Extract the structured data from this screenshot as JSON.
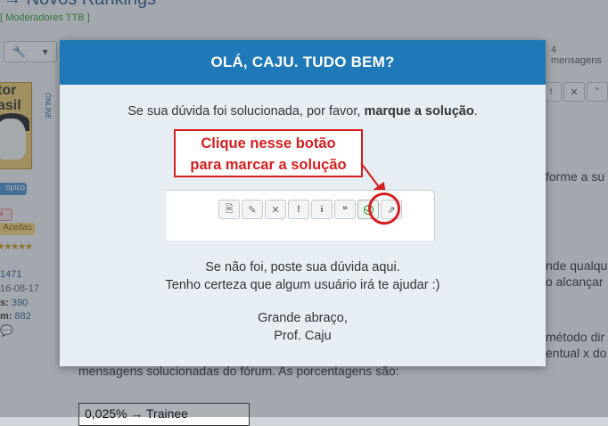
{
  "background": {
    "page_title": "→ Novos Rankings",
    "moderators": "[ Moderadores TTB ]",
    "post_count": "4 mensagens",
    "avatar_text": "tor asil",
    "topic_badge": "ópico",
    "badge_in": "IN",
    "badge_accepted": "Aceitas",
    "stat_posts": "1471",
    "stat_date": "16-08-17",
    "stat_a_label": "s:",
    "stat_a_value": "390",
    "stat_b_label": "m:",
    "stat_b_value": "882",
    "chat_icon": "💬",
    "post_buttons": [
      "!",
      "✕",
      "\""
    ],
    "text_lines": [
      "forme a su",
      "nde qualqu",
      "o alcançar",
      "método dir",
      "entual x do",
      "mensagens solucionadas do fórum. As porcentagens são:"
    ],
    "table_first_row": "0,025%  →  Trainee"
  },
  "modal": {
    "title": "OLÁ, CAJU. TUDO BEM?",
    "intro_prefix": "Se sua dúvida foi solucionada, por favor, ",
    "intro_bold": "marque a solução",
    "intro_suffix": ".",
    "callout_line1": "Clique nesse botão",
    "callout_line2": "para marcar a solução",
    "demo_buttons": [
      {
        "icon": "document-icon",
        "glyph": "🗎"
      },
      {
        "icon": "pencil-icon",
        "glyph": "✎"
      },
      {
        "icon": "x-icon",
        "glyph": "✕"
      },
      {
        "icon": "exclamation-icon",
        "glyph": "!"
      },
      {
        "icon": "info-icon",
        "glyph": "i"
      },
      {
        "icon": "quote-icon",
        "glyph": "❝"
      },
      {
        "icon": "check-circle-icon",
        "glyph": ""
      },
      {
        "icon": "share-icon",
        "glyph": "⇗"
      }
    ],
    "line_not_solved": "Se não foi, poste sua dúvida aqui.",
    "line_sure": "Tenho certeza que algum usuário irá te ajudar :)",
    "line_regards": "Grande abraço,",
    "line_signature": "Prof. Caju"
  },
  "colors": {
    "header": "#1f78b8",
    "callout_red": "#d31f1f",
    "check_green": "#2b9a2b"
  }
}
